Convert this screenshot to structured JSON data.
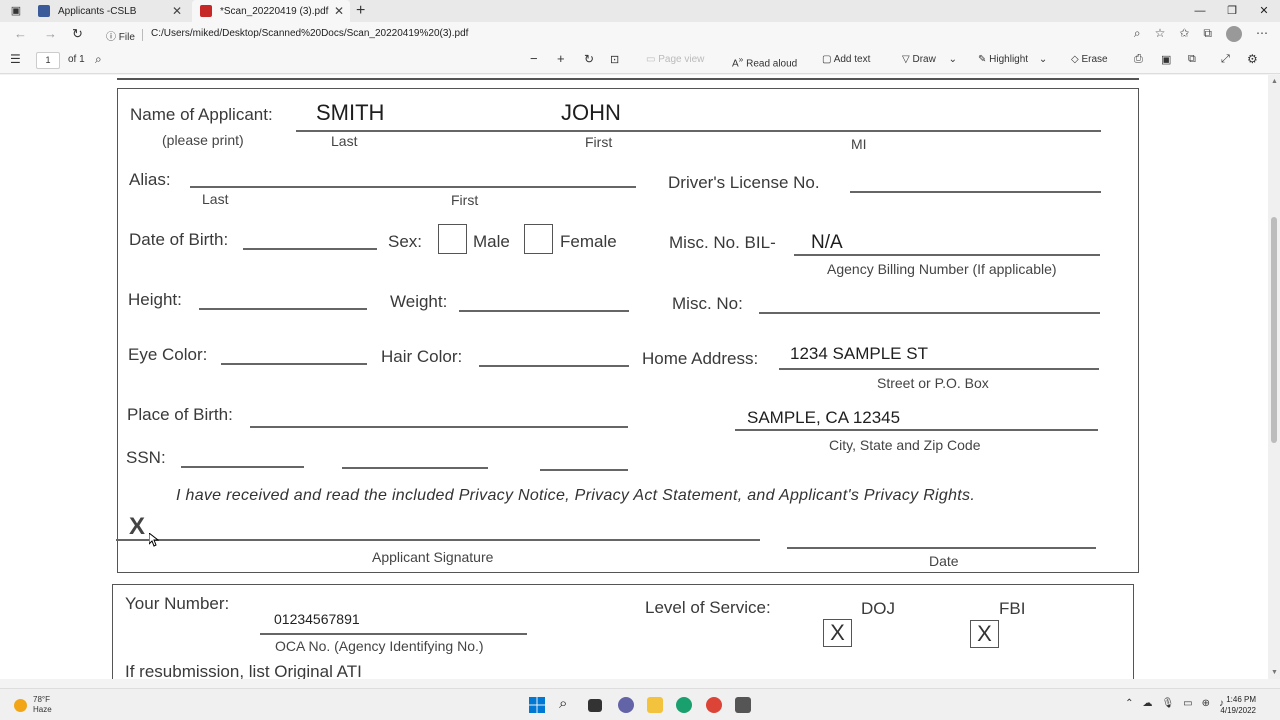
{
  "browser": {
    "tabs": [
      {
        "label": "Applicants -CSLB",
        "active": false
      },
      {
        "label": "*Scan_20220419 (3).pdf",
        "active": true
      }
    ],
    "address": {
      "info_label": "File",
      "url": "C:/Users/miked/Desktop/Scanned%20Docs/Scan_20220419%20(3).pdf"
    }
  },
  "pdf_toolbar": {
    "page_number": "1",
    "page_total": "of 1",
    "page_view": "Page view",
    "read_aloud": "Read aloud",
    "add_text": "Add text",
    "draw": "Draw",
    "highlight": "Highlight",
    "erase": "Erase"
  },
  "form": {
    "name_label": "Name of Applicant:",
    "please_print": "(please print)",
    "last_name": "SMITH",
    "first_name": "JOHN",
    "sub_last": "Last",
    "sub_first": "First",
    "sub_mi": "MI",
    "alias_label": "Alias:",
    "alias_last": "Last",
    "alias_first": "First",
    "dl_label": "Driver's License No.",
    "dob_label": "Date of Birth:",
    "sex_label": "Sex:",
    "male": "Male",
    "female": "Female",
    "misc_bil_label": "Misc. No. BIL-",
    "misc_bil_value": "N/A",
    "agency_billing": "Agency Billing Number (If applicable)",
    "height_label": "Height:",
    "weight_label": "Weight:",
    "misc_no_label": "Misc. No:",
    "eye_label": "Eye Color:",
    "hair_label": "Hair Color:",
    "home_label": "Home Address:",
    "street_value": "1234 SAMPLE ST",
    "street_sub": "Street or P.O. Box",
    "pob_label": "Place of Birth:",
    "city_value": "SAMPLE, CA 12345",
    "city_sub": "City, State and Zip Code",
    "ssn_label": "SSN:",
    "privacy_statement": "I have received and read the included Privacy Notice, Privacy Act Statement, and Applicant's Privacy Rights.",
    "sign_x": "X",
    "signature_label": "Applicant Signature",
    "date_label": "Date",
    "your_number_label": "Your Number:",
    "your_number_value": "01234567891",
    "oca_label": "OCA No. (Agency Identifying No.)",
    "service_label": "Level of Service:",
    "doj": "DOJ",
    "fbi": "FBI",
    "doj_mark": "X",
    "fbi_mark": "X",
    "resubmission": "If resubmission, list Original ATI"
  },
  "taskbar": {
    "temp": "78°F",
    "weather": "Haze",
    "time": "1:46 PM",
    "date": "4/19/2022"
  },
  "colors": {
    "edge_blue": "#1a73e8",
    "pdf_red": "#c62828",
    "win_blue": "#0078d4",
    "folder_yellow": "#f3c33d"
  }
}
